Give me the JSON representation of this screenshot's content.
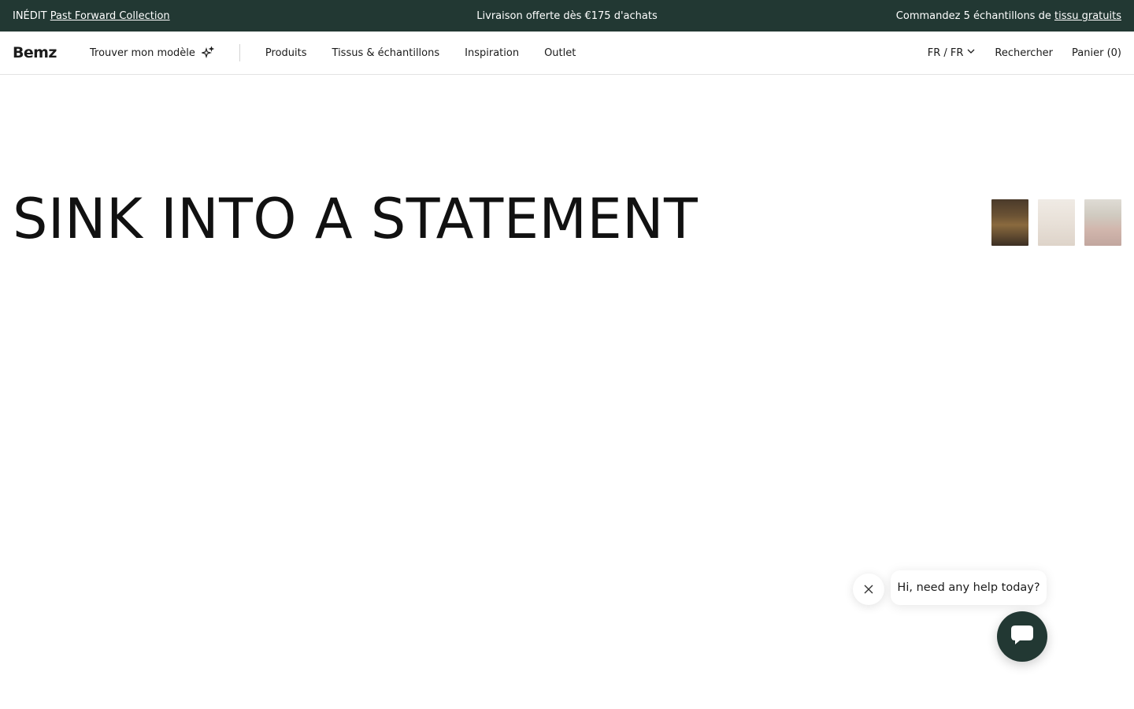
{
  "announcement": {
    "left_prefix": "INÉDIT",
    "left_link": "Past Forward Collection",
    "center": "Livraison offerte dès €175 d'achats",
    "right_prefix": "Commandez 5 échantillons de",
    "right_link": "tissu gratuits"
  },
  "header": {
    "logo": "Bemz",
    "find_model": "Trouver mon modèle",
    "nav": [
      "Produits",
      "Tissus & échantillons",
      "Inspiration",
      "Outlet"
    ],
    "language": "FR / FR",
    "search": "Rechercher",
    "cart": "Panier (0)"
  },
  "hero": {
    "title": "SINK INTO A STATEMENT"
  },
  "chat": {
    "message": "Hi, need any help today?"
  },
  "colors": {
    "brand_dark": "#223833"
  }
}
